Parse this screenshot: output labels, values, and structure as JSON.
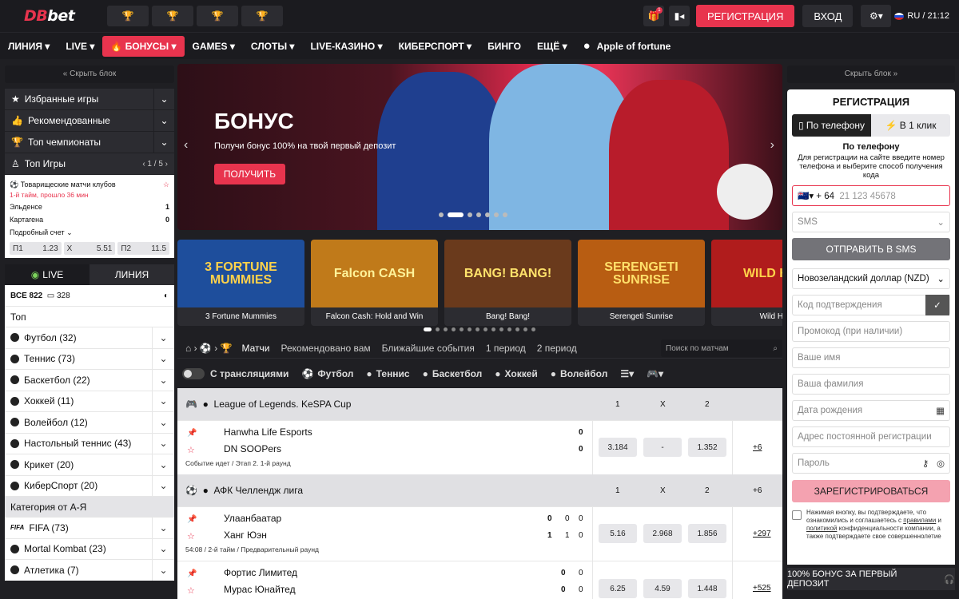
{
  "header": {
    "logo_db": "DB",
    "logo_bet": "bet",
    "gift_badge": "1",
    "register": "РЕГИСТРАЦИЯ",
    "login": "ВХОД",
    "lang_time": "RU / 21:12"
  },
  "nav": [
    "ЛИНИЯ",
    "LIVE",
    "БОНУСЫ",
    "GAMES",
    "СЛОТЫ",
    "LIVE-КАЗИНО",
    "КИБЕРСПОРТ",
    "БИНГО",
    "ЕЩЁ"
  ],
  "nav_apple": "Apple of fortune",
  "left": {
    "hide": "« Скрыть блок",
    "rows": [
      "Избранные игры",
      "Рекомендованные",
      "Топ чемпионаты"
    ],
    "top_games_label": "Топ Игры",
    "top_games_page": "1 / 5",
    "top_game": {
      "league": "Товарищеские матчи клубов",
      "status": "1-й тайм, прошло 36 мин",
      "team1": "Эльденсе",
      "score1": "1",
      "team2": "Картагена",
      "score2": "0",
      "detail": "Подробный счет",
      "odds": [
        {
          "k": "П1",
          "v": "1.23"
        },
        {
          "k": "Х",
          "v": "5.51"
        },
        {
          "k": "П2",
          "v": "11.5"
        }
      ]
    },
    "tab_live": "LIVE",
    "tab_line": "ЛИНИЯ",
    "all_label": "ВСЕ 822",
    "all_count": "328",
    "top_label": "Топ",
    "sports": [
      "Футбол (32)",
      "Теннис (73)",
      "Баскетбол (22)",
      "Хоккей (11)",
      "Волейбол (12)",
      "Настольный теннис (43)",
      "Крикет (20)",
      "КиберСпорт (20)"
    ],
    "category_label": "Категория от А-Я",
    "sports2": [
      "FIFA (73)",
      "Mortal Kombat (23)",
      "Атлетика (7)"
    ]
  },
  "banner": {
    "title": "БОНУС",
    "subtitle": "Получи бонус 100% на твой первый депозит",
    "button": "ПОЛУЧИТЬ",
    "slides_total": 7,
    "active_slide": 2
  },
  "games": [
    {
      "art": "3 FORTUNE MUMMIES",
      "name": "3 Fortune Mummies",
      "color": "#1e4e9c"
    },
    {
      "art": "Falcon CASH",
      "name": "Falcon Cash: Hold and Win",
      "color": "#c07a1a"
    },
    {
      "art": "BANG! BANG!",
      "name": "Bang! Bang!",
      "color": "#6a3a1c"
    },
    {
      "art": "SERENGETI SUNRISE",
      "name": "Serengeti Sunrise",
      "color": "#b85d12"
    },
    {
      "art": "WILD HOT",
      "name": "Wild Hot",
      "color": "#b01c1c"
    }
  ],
  "center": {
    "tabs": [
      "Матчи",
      "Рекомендовано вам",
      "Ближайшие события",
      "1 период",
      "2 период"
    ],
    "search_placeholder": "Поиск по матчам",
    "with_streams": "С трансляциями",
    "filters": [
      "Футбол",
      "Теннис",
      "Баскетбол",
      "Хоккей",
      "Волейбол"
    ],
    "col1": "1",
    "colx": "X",
    "col2": "2",
    "league1": "League of Legends. KeSPA Cup",
    "m1": {
      "t1": "Hanwha Life Esports",
      "t2": "DN SOOPers",
      "s1": "0",
      "s2": "0",
      "info": "Событие идет / Этап 2. 1-й раунд",
      "o1": "3.184",
      "ox": "-",
      "o2": "1.352",
      "more": "+6"
    },
    "league2": "АФК Челлендж лига",
    "league2_more": "+6",
    "m2": {
      "t1": "Улаанбаатар",
      "t2": "Ханг Юэн",
      "s1": "0",
      "s1b": "0",
      "s1c": "0",
      "s2": "1",
      "s2b": "1",
      "s2c": "0",
      "info": "54:08 / 2-й тайм / Предварительный раунд",
      "o1": "5.16",
      "ox": "2.968",
      "o2": "1.856",
      "more": "+297"
    },
    "m3": {
      "t1": "Фортис Лимитед",
      "t2": "Мурас Юнайтед",
      "s1": "0",
      "s1b": "0",
      "s2": "0",
      "s2b": "0",
      "o1": "6.25",
      "ox": "4.59",
      "o2": "1.448",
      "more": "+525"
    }
  },
  "right": {
    "hide": "Скрыть блок »",
    "title": "РЕГИСТРАЦИЯ",
    "tab_phone": "По телефону",
    "tab_oneclick": "В 1 клик",
    "phone_title": "По телефону",
    "phone_desc": "Для регистрации на сайте введите номер телефона и выберите способ получения кода",
    "phone_code": "+ 64",
    "phone_placeholder": "21 123 45678",
    "method": "SMS",
    "send": "ОТПРАВИТЬ В SMS",
    "currency": "Новозеландский доллар (NZD)",
    "code_placeholder": "Код подтверждения",
    "promo_placeholder": "Промокод (при наличии)",
    "name_placeholder": "Ваше имя",
    "surname_placeholder": "Ваша фамилия",
    "dob_placeholder": "Дата рождения",
    "address_placeholder": "Адрес постоянной регистрации",
    "password_placeholder": "Пароль",
    "submit": "ЗАРЕГИСТРИРОВАТЬСЯ",
    "agree_1": "Нажимая кнопку, вы подтверждаете, что ознакомились и соглашаетесь с ",
    "agree_rules": "правилами",
    "agree_2": " и ",
    "agree_policy": "политикой",
    "agree_3": " конфиденциальности компании, а также подтверждаете свое совершеннолетие",
    "bonus_bar": "100% БОНУС ЗА ПЕРВЫЙ ДЕПОЗИТ"
  },
  "colors": {
    "accent": "#e8344e",
    "bg": "#1f1f23",
    "panel": "#2c2c31"
  }
}
